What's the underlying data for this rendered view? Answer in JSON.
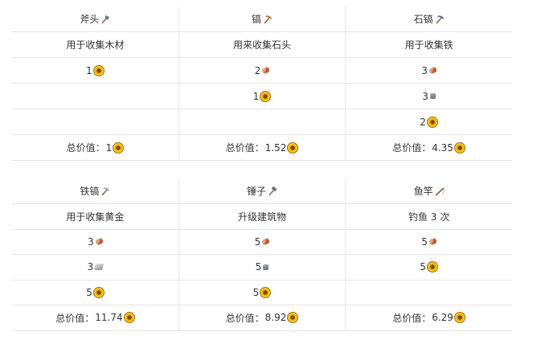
{
  "colors": {
    "coin": "#f1b600",
    "wood": "#b25a3a",
    "stone": "#5c6a76",
    "iron": "#8d959b"
  },
  "table1": {
    "columns": [
      {
        "name": "斧头",
        "tool_icon": "axe-icon",
        "desc": "用于收集木材",
        "costs": [
          {
            "qty": "1",
            "icon": "coin-icon"
          },
          null,
          null
        ],
        "total_label": "总价值：",
        "total_value": "1"
      },
      {
        "name": "镐",
        "tool_icon": "pickaxe-icon",
        "desc": "用来收集石头",
        "costs": [
          {
            "qty": "2",
            "icon": "wood-icon"
          },
          {
            "qty": "1",
            "icon": "coin-icon"
          },
          null
        ],
        "total_label": "总价值：",
        "total_value": "1.52"
      },
      {
        "name": "石镐",
        "tool_icon": "stone-pickaxe-icon",
        "desc": "用于收集铁",
        "costs": [
          {
            "qty": "3",
            "icon": "wood-icon"
          },
          {
            "qty": "3",
            "icon": "stone-icon"
          },
          {
            "qty": "2",
            "icon": "coin-icon"
          }
        ],
        "total_label": "总价值：",
        "total_value": "4.35"
      }
    ]
  },
  "table2": {
    "columns": [
      {
        "name": "铁镐",
        "tool_icon": "iron-pickaxe-icon",
        "desc": "用于收集黄金",
        "costs": [
          {
            "qty": "3",
            "icon": "wood-icon"
          },
          {
            "qty": "3",
            "icon": "iron-icon"
          },
          {
            "qty": "5",
            "icon": "coin-icon"
          }
        ],
        "total_label": "总价值：",
        "total_value": "11.74"
      },
      {
        "name": "锤子",
        "tool_icon": "hammer-icon",
        "desc": "升级建筑物",
        "costs": [
          {
            "qty": "5",
            "icon": "wood-icon"
          },
          {
            "qty": "5",
            "icon": "stone-icon"
          },
          {
            "qty": "5",
            "icon": "coin-icon"
          }
        ],
        "total_label": "总价值：",
        "total_value": "8.92"
      },
      {
        "name": "鱼竿",
        "tool_icon": "fishing-rod-icon",
        "desc": "钓鱼 3 次",
        "costs": [
          {
            "qty": "5",
            "icon": "wood-icon"
          },
          {
            "qty": "5",
            "icon": "coin-icon"
          },
          null
        ],
        "total_label": "总价值：",
        "total_value": "6.29"
      }
    ]
  }
}
